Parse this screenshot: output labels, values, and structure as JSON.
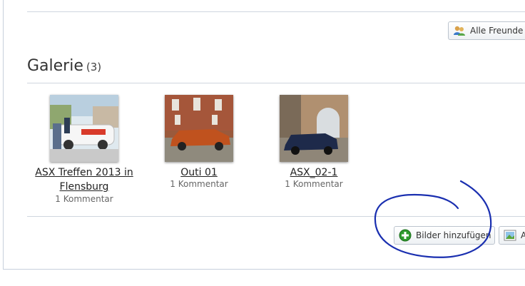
{
  "friends_button": {
    "label": "Alle Freunde",
    "icon": "friends-icon"
  },
  "gallery": {
    "title": "Galerie",
    "count": "(3)",
    "items": [
      {
        "title": "ASX Treffen 2013 in Flensburg",
        "comments": "1 Kommentar"
      },
      {
        "title": "Outi 01",
        "comments": "1 Kommentar"
      },
      {
        "title": "ASX_02-1",
        "comments": "1 Kommentar"
      }
    ]
  },
  "actions": {
    "add_images": {
      "label": "Bilder hinzufügen",
      "icon": "add-icon"
    },
    "album": {
      "label": "A",
      "icon": "image-icon"
    }
  },
  "colors": {
    "annotation_circle": "#1a2fb0",
    "add_icon": "#2e9a2e"
  }
}
